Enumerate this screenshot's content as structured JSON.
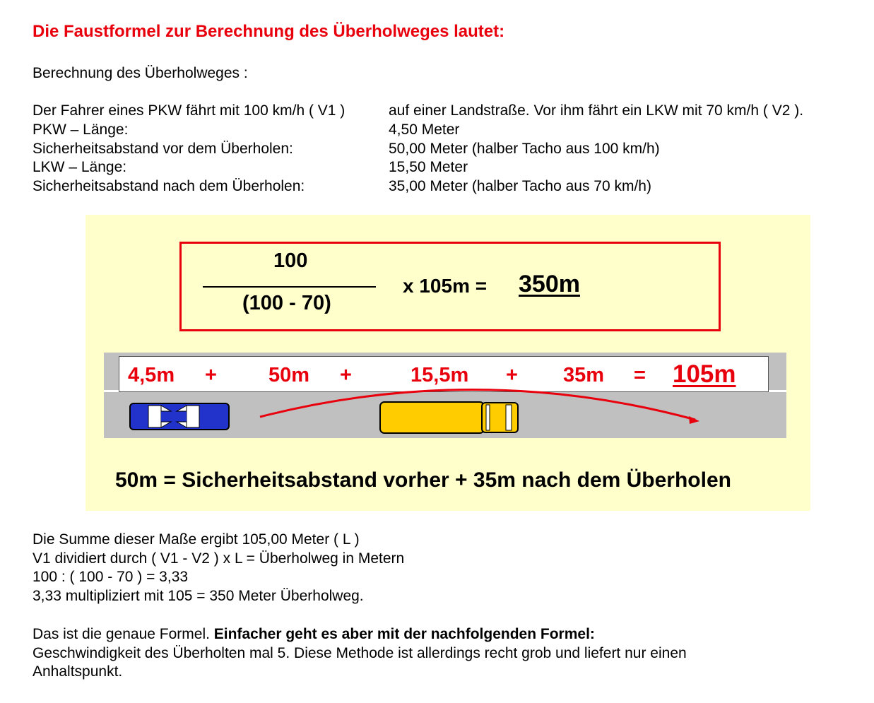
{
  "heading": "Die Faustformel zur Berechnung des Überholweges lautet:",
  "subheading": "Berechnung des Überholweges :",
  "intro": {
    "left": "Der Fahrer eines PKW fährt mit 100 km/h ( V1 )",
    "right": "auf einer Landstraße. Vor ihm fährt ein LKW mit 70 km/h ( V2 )."
  },
  "specs": [
    {
      "label": "PKW – Länge:",
      "value": "4,50 Meter"
    },
    {
      "label": "Sicherheitsabstand vor dem Überholen:",
      "value": "50,00 Meter (halber Tacho aus 100 km/h)"
    },
    {
      "label": "LKW – Länge:",
      "value": "15,50 Meter"
    },
    {
      "label": "Sicherheitsabstand nach dem Überholen:",
      "value": "35,00 Meter (halber Tacho aus 70 km/h)"
    }
  ],
  "formula": {
    "numerator": "100",
    "denominator": "(100 - 70)",
    "multiplier": "x 105m  =",
    "result": "350m"
  },
  "sum": {
    "pkw": "4,5m",
    "plus1": "+",
    "gap_before": "50m",
    "plus2": "+",
    "lkw": "15,5m",
    "plus3": "+",
    "gap_after": "35m",
    "equals": "=",
    "total": "105m"
  },
  "caption": "50m = Sicherheitsabstand vorher + 35m nach dem Überholen",
  "explanation": [
    "Die Summe dieser Maße ergibt 105,00 Meter ( L )",
    "V1 dividiert durch ( V1 - V2 ) x  L = Überholweg in Metern",
    "100 : ( 100 - 70 ) = 3,33",
    "3,33 multipliziert mit 105 = 350 Meter Überholweg."
  ],
  "footer": {
    "normal": "Das ist die genaue Formel. ",
    "bold": "Einfacher geht es aber mit der nachfolgenden Formel:",
    "line2": "Geschwindigkeit des Überholten mal 5. Diese Methode ist allerdings recht grob und liefert nur einen",
    "line3": "Anhaltspunkt."
  },
  "colors": {
    "accent_red": "#e8000d",
    "panel_bg": "#ffffcc",
    "road": "#c0c0c0",
    "car_blue": "#2233cc",
    "truck_yellow": "#ffcc00"
  }
}
